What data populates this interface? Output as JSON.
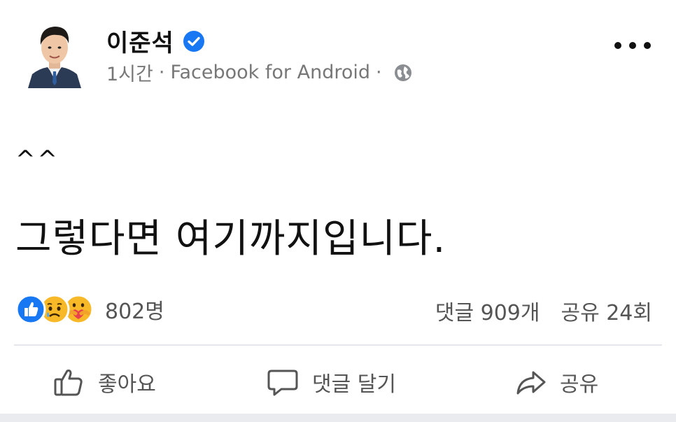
{
  "post": {
    "author": "이준석",
    "time": "1시간",
    "source": "Facebook for Android",
    "text_line1": "^^",
    "text_line2": "그렇다면 여기까지입니다."
  },
  "reactions": {
    "types": [
      "like-icon",
      "sad-icon",
      "care-icon"
    ],
    "count": "802명"
  },
  "stats": {
    "comments": "댓글 909개",
    "shares": "공유 24회"
  },
  "actions": {
    "like": "좋아요",
    "comment": "댓글 달기",
    "share": "공유"
  },
  "colors": {
    "verified": "#1877f2",
    "like_reaction": "#1877f2",
    "emoji_yellow": "#f7b928",
    "text_secondary": "#555555"
  }
}
